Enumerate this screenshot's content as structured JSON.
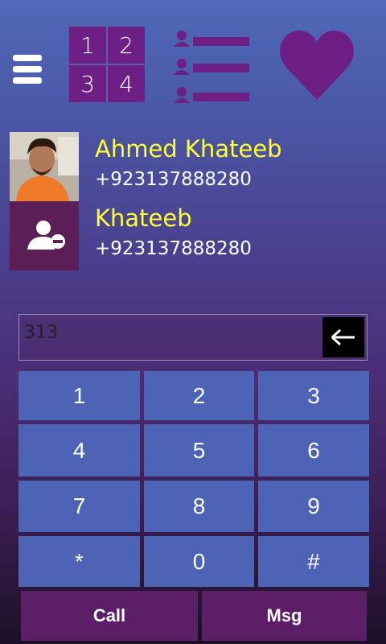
{
  "toolbar": {
    "menu_icon": "hamburger-menu-icon",
    "dialpad_tiles": [
      "1",
      "2",
      "3",
      "4"
    ],
    "contacts_icon": "contact-list-icon",
    "favorites_icon": "heart-icon",
    "accent_color": "#6d1f85"
  },
  "contacts": [
    {
      "name": "Ahmed Khateeb",
      "phone": "+923137888280",
      "avatar": "photo"
    },
    {
      "name": "Khateeb",
      "phone": "+923137888280",
      "avatar": "person-remove-icon"
    }
  ],
  "dialer": {
    "input_value": "313",
    "backspace_icon": "backspace-arrow-icon"
  },
  "keypad": {
    "keys": [
      "1",
      "2",
      "3",
      "4",
      "5",
      "6",
      "7",
      "8",
      "9",
      "*",
      "0",
      "#"
    ]
  },
  "actions": {
    "call_label": "Call",
    "msg_label": "Msg"
  },
  "colors": {
    "name_text": "#ffff32",
    "key_bg": "#4d63b5",
    "action_bg": "#5c1e66"
  }
}
